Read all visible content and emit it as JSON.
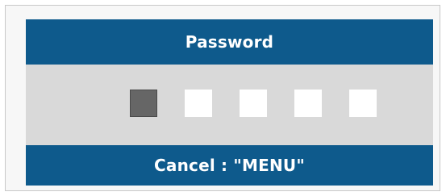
{
  "dialog": {
    "title": "Password",
    "footer_text": "Cancel  :  \"MENU\"",
    "slots": [
      {
        "state": "active"
      },
      {
        "state": "empty"
      },
      {
        "state": "empty"
      },
      {
        "state": "empty"
      },
      {
        "state": "empty"
      }
    ]
  },
  "colors": {
    "bar": "#0e5a8c",
    "body": "#d9d9d9",
    "slot_empty": "#ffffff",
    "slot_active": "#666666"
  }
}
